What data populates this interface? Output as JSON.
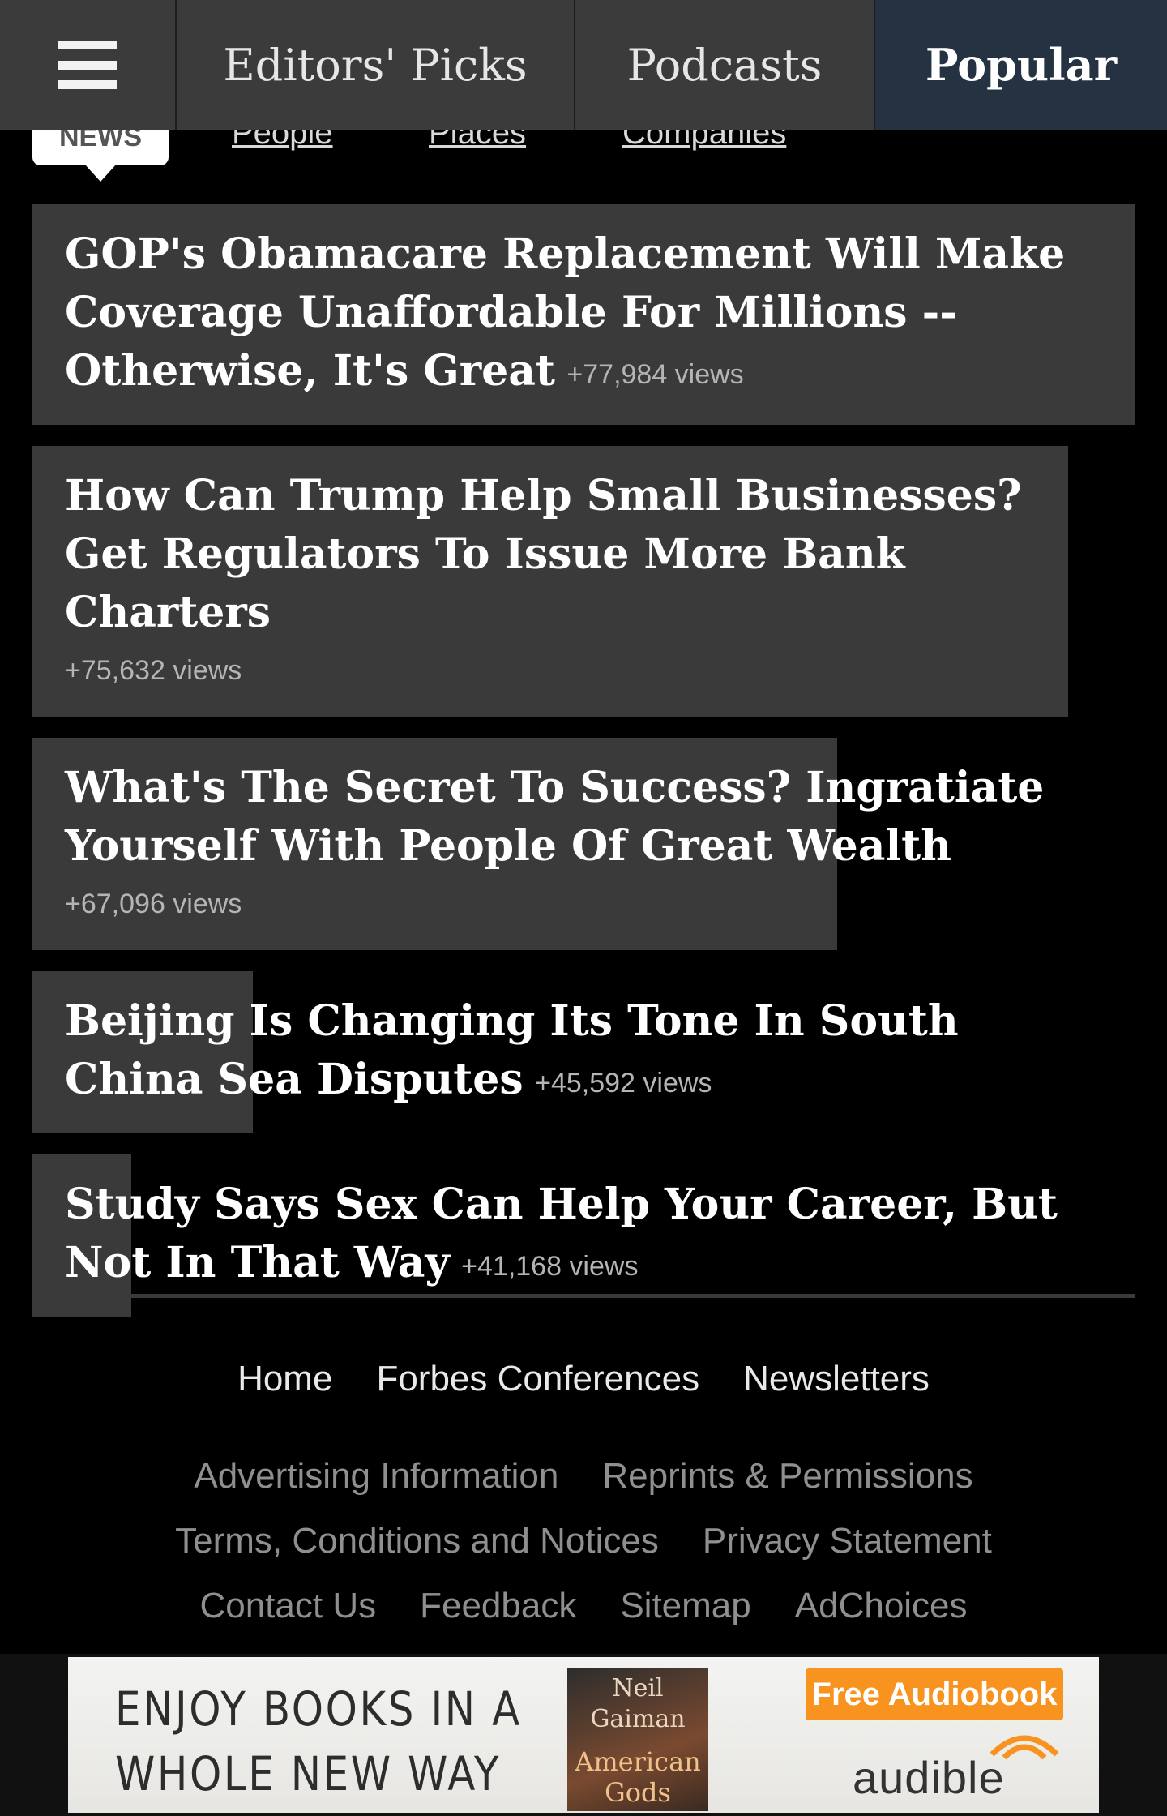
{
  "nav": {
    "menu_icon": "hamburger-menu-icon",
    "tabs": [
      {
        "label": "Editors' Picks"
      },
      {
        "label": "Podcasts"
      },
      {
        "label": "Popular",
        "active": true
      }
    ],
    "active_color": "#253242"
  },
  "subnav": {
    "active_label": "NEWS",
    "links": [
      {
        "label": "People"
      },
      {
        "label": "Places"
      },
      {
        "label": "Companies"
      }
    ]
  },
  "articles": [
    {
      "title": "GOP's Obamacare Replacement Will Make Coverage Unaffordable For Millions -- Otherwise, It's Great",
      "views": "+77,984 views",
      "relative_popularity": 1.0
    },
    {
      "title": "How Can Trump Help Small Businesses? Get Regulators To Issue More Bank Charters",
      "views": "+75,632 views",
      "relative_popularity": 0.94
    },
    {
      "title": "What's The Secret To Success? Ingratiate Yourself With People Of Great Wealth",
      "views": "+67,096 views",
      "relative_popularity": 0.73
    },
    {
      "title": "Beijing Is Changing Its Tone In South China Sea Disputes",
      "views": "+45,592 views",
      "relative_popularity": 0.2
    },
    {
      "title": "Study Says Sex Can Help Your Career, But Not In That Way",
      "views": "+41,168 views",
      "relative_popularity": 0.09
    }
  ],
  "footer": {
    "primary_links": [
      {
        "label": "Home"
      },
      {
        "label": "Forbes Conferences"
      },
      {
        "label": "Newsletters"
      }
    ],
    "secondary_links": [
      {
        "label": "Advertising Information"
      },
      {
        "label": "Reprints & Permissions"
      },
      {
        "label": "Terms, Conditions and Notices"
      },
      {
        "label": "Privacy Statement"
      },
      {
        "label": "Contact Us"
      },
      {
        "label": "Feedback"
      },
      {
        "label": "Sitemap"
      },
      {
        "label": "AdChoices"
      }
    ]
  },
  "ad": {
    "headline_line1": "ENJOY BOOKS IN A",
    "headline_line2": "WHOLE NEW WAY",
    "book_author": "Neil Gaiman",
    "book_title": "American Gods",
    "cta": "Free Audiobook",
    "brand": "audible",
    "cta_color": "#f7931e"
  }
}
